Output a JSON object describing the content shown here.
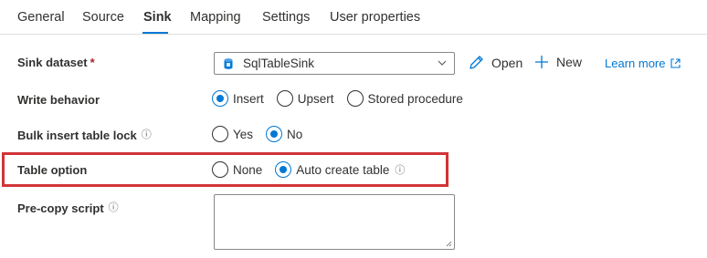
{
  "tabs": [
    {
      "label": "General"
    },
    {
      "label": "Source"
    },
    {
      "label": "Sink"
    },
    {
      "label": "Mapping"
    },
    {
      "label": "Settings"
    },
    {
      "label": "User properties"
    }
  ],
  "active_tab": "Sink",
  "sink_dataset": {
    "label": "Sink dataset",
    "required_marker": "*",
    "value": "SqlTableSink",
    "icon": "sql-database-icon",
    "actions": {
      "open_label": "Open",
      "new_label": "New",
      "learn_more_label": "Learn more"
    }
  },
  "write_behavior": {
    "label": "Write behavior",
    "options": [
      "Insert",
      "Upsert",
      "Stored procedure"
    ],
    "selected": "Insert"
  },
  "bulk_insert_table_lock": {
    "label": "Bulk insert table lock",
    "info_icon": "ⓘ",
    "options": [
      "Yes",
      "No"
    ],
    "selected": "No"
  },
  "table_option": {
    "label": "Table option",
    "options": [
      "None",
      "Auto create table"
    ],
    "selected": "Auto create table",
    "info_icon": "ⓘ"
  },
  "pre_copy_script": {
    "label": "Pre-copy script",
    "info_icon": "ⓘ",
    "value": ""
  },
  "colors": {
    "accent": "#0078d4",
    "highlight": "#d13438",
    "required": "#a4262c"
  }
}
